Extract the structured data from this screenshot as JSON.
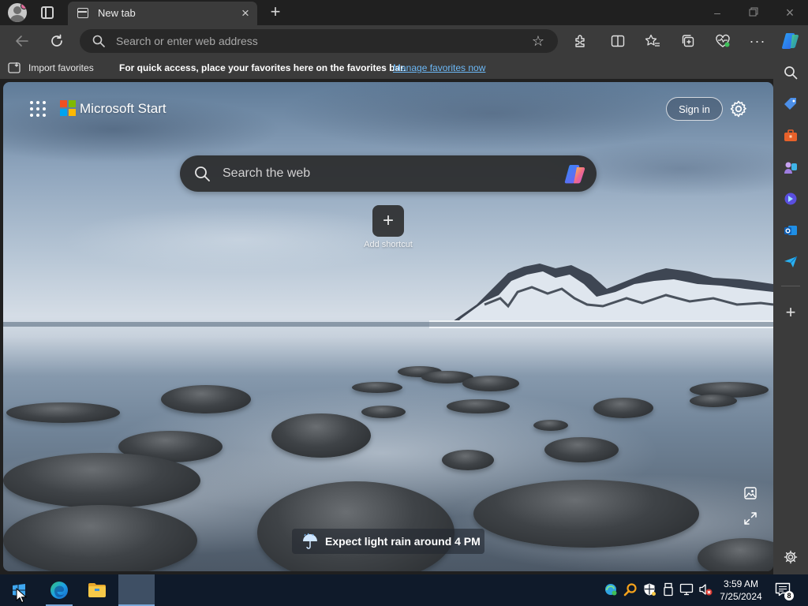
{
  "browser": {
    "tab": {
      "title": "New tab"
    },
    "address_bar": {
      "placeholder": "Search or enter web address",
      "value": ""
    },
    "favorites_bar": {
      "import_label": "Import favorites",
      "message": "For quick access, place your favorites here on the favorites bar.",
      "manage_link": "Manage favorites now"
    }
  },
  "start_page": {
    "brand": "Microsoft Start",
    "sign_in": "Sign in",
    "search_placeholder": "Search the web",
    "add_shortcut_label": "Add shortcut",
    "weather": "Expect light rain around 4 PM"
  },
  "taskbar": {
    "time": "3:59 AM",
    "date": "7/25/2024",
    "notification_count": "8"
  },
  "colors": {
    "ms_red": "#f25022",
    "ms_green": "#7fba00",
    "ms_blue": "#00a4ef",
    "ms_yellow": "#ffb900",
    "link": "#6cb8f6",
    "sidebar_bg": "#3b3b3b",
    "taskbar_bg": "#0f1a2a"
  },
  "icons": {
    "title_bar": [
      "profile-icon",
      "workspaces-icon",
      "tab-page-icon",
      "close-icon",
      "new-tab-icon",
      "minimize-icon",
      "restore-icon",
      "close-window-icon"
    ],
    "toolbar": [
      "back-icon",
      "refresh-icon",
      "search-icon",
      "favorite-star-icon",
      "extensions-icon",
      "split-screen-icon",
      "favorites-icon",
      "collections-icon",
      "performance-icon",
      "more-icon",
      "copilot-icon"
    ],
    "sidebar": [
      "search-icon",
      "shopping-tag-icon",
      "tools-icon",
      "games-icon",
      "bing-chat-icon",
      "outlook-icon",
      "send-icon",
      "add-icon",
      "settings-icon"
    ]
  }
}
